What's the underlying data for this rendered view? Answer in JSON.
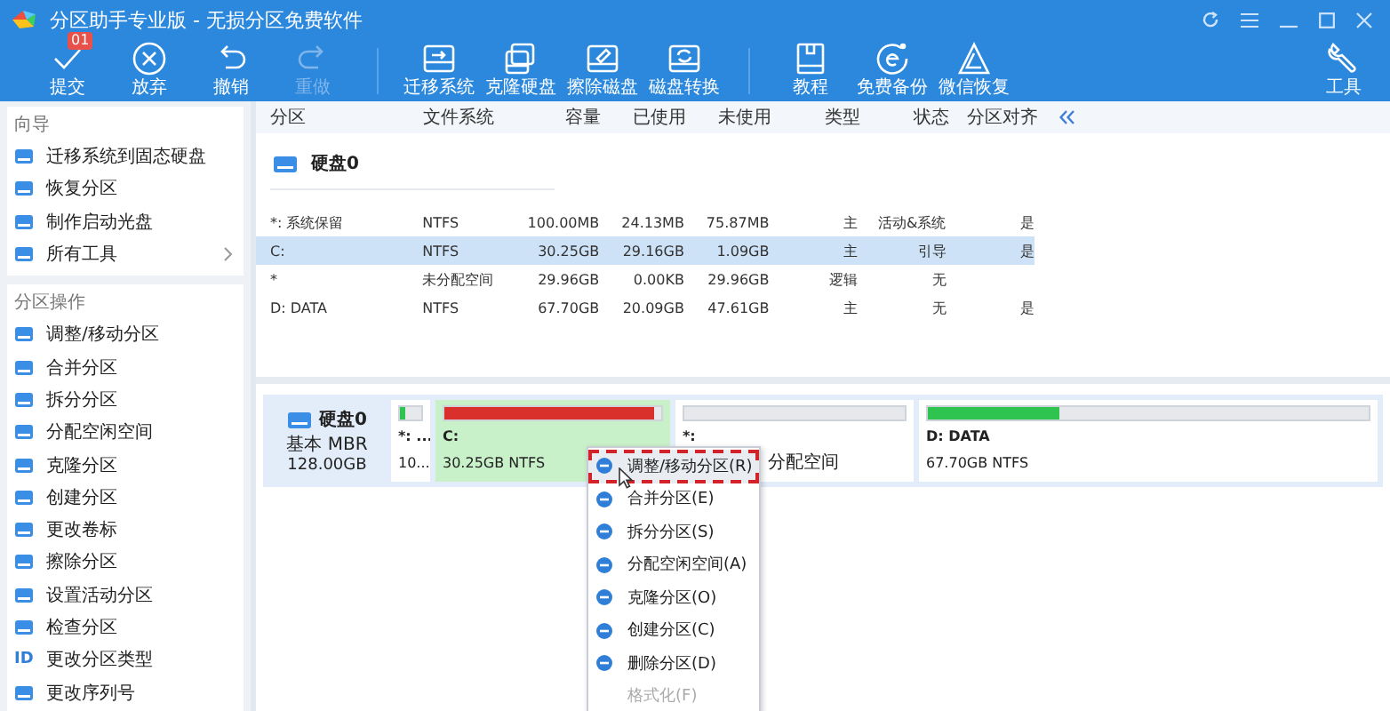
{
  "window": {
    "title": "分区助手专业版 - 无损分区免费软件"
  },
  "toolbar": {
    "groups": [
      [
        {
          "label": "提交",
          "disabled": false,
          "badge": "01"
        },
        {
          "label": "放弃",
          "disabled": false
        },
        {
          "label": "撤销",
          "disabled": false
        },
        {
          "label": "重做",
          "disabled": true
        }
      ],
      [
        {
          "label": "迁移系统",
          "disabled": false
        },
        {
          "label": "克隆硬盘",
          "disabled": false
        },
        {
          "label": "擦除磁盘",
          "disabled": false
        },
        {
          "label": "磁盘转换",
          "disabled": false
        }
      ],
      [
        {
          "label": "教程",
          "disabled": false
        },
        {
          "label": "免费备份",
          "disabled": false
        },
        {
          "label": "微信恢复",
          "disabled": false
        }
      ]
    ],
    "tools": {
      "label": "工具"
    }
  },
  "sidebar": {
    "sections": [
      {
        "title": "向导",
        "items": [
          {
            "label": "迁移系统到固态硬盘"
          },
          {
            "label": "恢复分区"
          },
          {
            "label": "制作启动光盘"
          },
          {
            "label": "所有工具",
            "has_submenu": true
          }
        ]
      },
      {
        "title": "分区操作",
        "items": [
          {
            "label": "调整/移动分区"
          },
          {
            "label": "合并分区"
          },
          {
            "label": "拆分分区"
          },
          {
            "label": "分配空闲空间"
          },
          {
            "label": "克隆分区"
          },
          {
            "label": "创建分区"
          },
          {
            "label": "更改卷标"
          },
          {
            "label": "擦除分区"
          },
          {
            "label": "设置活动分区"
          },
          {
            "label": "检查分区"
          },
          {
            "label": "更改分区类型",
            "badge": "ID"
          },
          {
            "label": "更改序列号"
          }
        ]
      }
    ]
  },
  "table": {
    "columns": [
      "分区",
      "文件系统",
      "容量",
      "已使用",
      "未使用",
      "类型",
      "状态",
      "分区对齐"
    ],
    "disk": "硬盘0",
    "rows": [
      {
        "cells": [
          "*: 系统保留",
          "NTFS",
          "100.00MB",
          "24.13MB",
          "75.87MB",
          "主",
          "活动&系统",
          "是"
        ],
        "selected": false
      },
      {
        "cells": [
          "C:",
          "NTFS",
          "30.25GB",
          "29.16GB",
          "1.09GB",
          "主",
          "引导",
          "是"
        ],
        "selected": true
      },
      {
        "cells": [
          "*",
          "未分配空间",
          "29.96GB",
          "0.00KB",
          "29.96GB",
          "逻辑",
          "无",
          ""
        ],
        "selected": false
      },
      {
        "cells": [
          "D: DATA",
          "NTFS",
          "67.70GB",
          "20.09GB",
          "47.61GB",
          "主",
          "无",
          "是"
        ],
        "selected": false
      }
    ]
  },
  "disk_map": {
    "name": "硬盘0",
    "type": "基本 MBR",
    "size": "128.00GB",
    "partitions": [
      {
        "label": "*: ...",
        "detail": "10...",
        "level": 0.25,
        "color": "#2fc450",
        "selected": false
      },
      {
        "label": "C:",
        "detail": "30.25GB NTFS",
        "level": 0.97,
        "color": "#d9302c",
        "selected": true
      },
      {
        "label": "*:",
        "detail": "分配空间",
        "selected": false
      },
      {
        "label": "D: DATA",
        "detail": "67.70GB NTFS",
        "level": 0.3,
        "color": "#2fc450",
        "selected": false
      }
    ]
  },
  "context_menu": {
    "items": [
      {
        "label": "调整/移动分区(R)",
        "selected": true,
        "disabled": false
      },
      {
        "label": "合并分区(E)",
        "selected": false,
        "disabled": false
      },
      {
        "label": "拆分分区(S)",
        "selected": false,
        "disabled": false
      },
      {
        "label": "分配空闲空间(A)",
        "selected": false,
        "disabled": false
      },
      {
        "label": "克隆分区(O)",
        "selected": false,
        "disabled": false
      },
      {
        "label": "创建分区(C)",
        "selected": false,
        "disabled": false
      },
      {
        "label": "删除分区(D)",
        "selected": false,
        "disabled": false
      },
      {
        "label": "格式化(F)",
        "selected": false,
        "disabled": true
      }
    ]
  }
}
